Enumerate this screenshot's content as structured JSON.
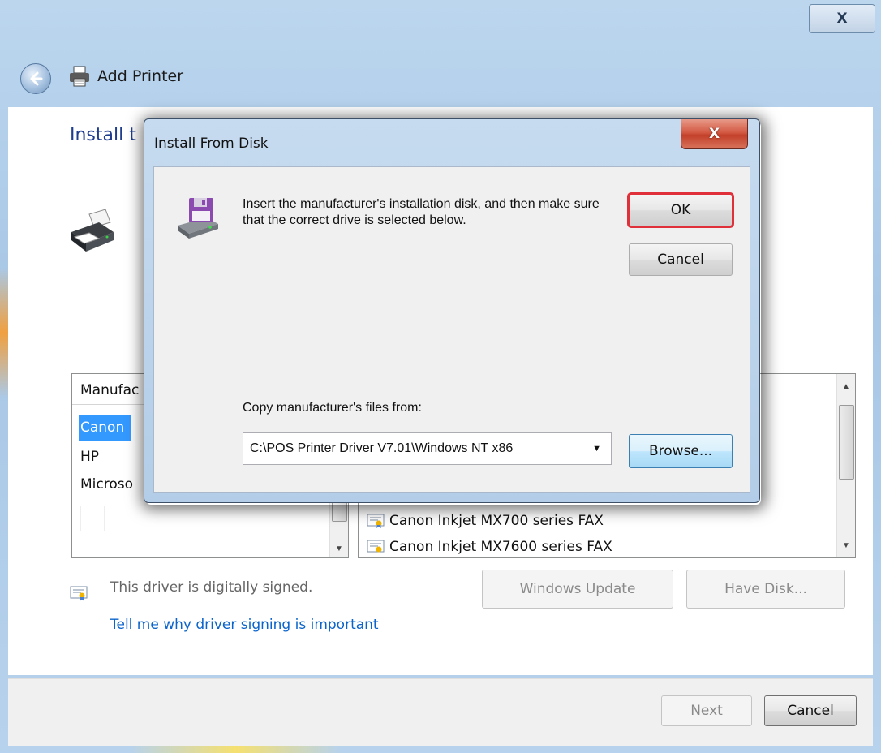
{
  "window": {
    "close_glyph": "X",
    "title": "Add Printer",
    "page_title": "Install t"
  },
  "manufacturers": {
    "header": "Manufac",
    "items": [
      "Canon",
      "HP",
      "Microso"
    ]
  },
  "models": {
    "items": [
      "Canon Inkjet MX700 series FAX",
      "Canon Inkjet MX7600 series FAX"
    ]
  },
  "signing": {
    "status": "This driver is digitally signed.",
    "link": "Tell me why driver signing is important"
  },
  "buttons": {
    "windows_update": "Windows Update",
    "have_disk": "Have Disk...",
    "next": "Next",
    "cancel": "Cancel"
  },
  "dialog": {
    "title": "Install From Disk",
    "close_glyph": "X",
    "message": "Insert the manufacturer's installation disk, and then make sure that the correct drive is selected below.",
    "ok": "OK",
    "cancel": "Cancel",
    "copy_label": "Copy manufacturer's files from:",
    "path": "C:\\POS Printer Driver V7.01\\Windows NT x86",
    "browse": "Browse..."
  },
  "colors": {
    "accent_link": "#0a64cc",
    "title_blue": "#1e3d8f",
    "selection": "#3399ff",
    "highlight_box": "#e0303a"
  }
}
